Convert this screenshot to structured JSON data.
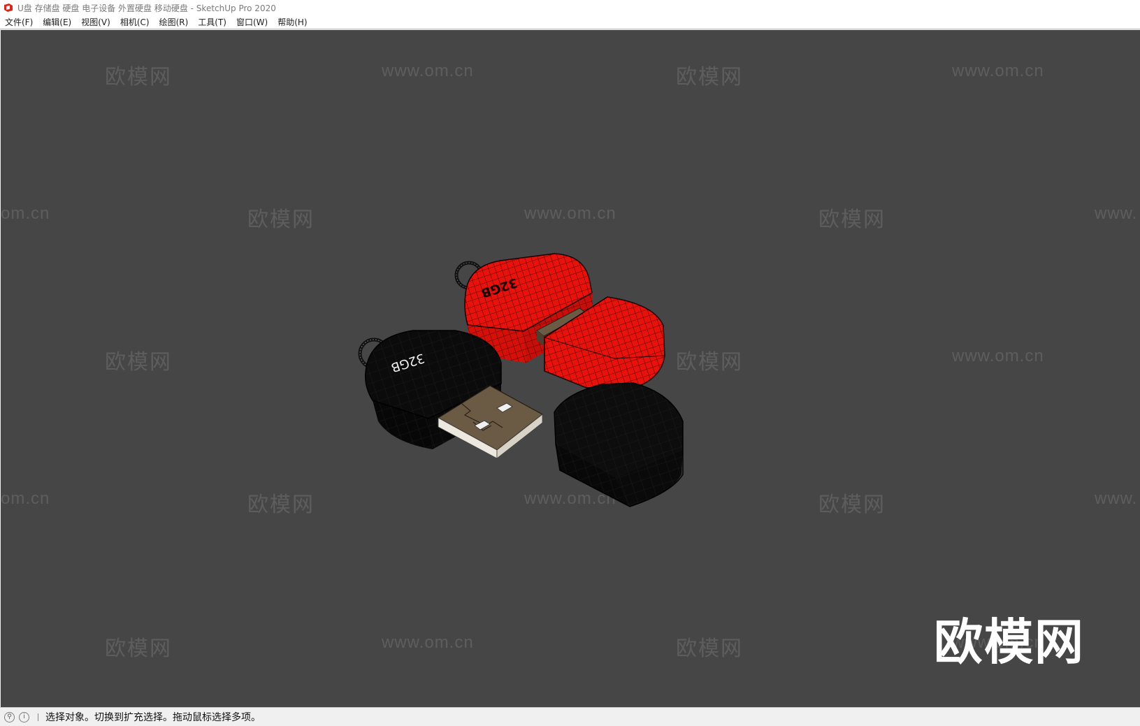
{
  "window": {
    "title": "U盘 存储盘 硬盘 电子设备 外置硬盘 移动硬盘 - SketchUp Pro 2020",
    "app_icon": "sketchup-icon"
  },
  "menu": {
    "items": [
      "文件(F)",
      "编辑(E)",
      "视图(V)",
      "相机(C)",
      "绘图(R)",
      "工具(T)",
      "窗口(W)",
      "帮助(H)"
    ]
  },
  "viewport": {
    "background": "#464646",
    "watermark_cn": "欧模网",
    "watermark_url": "www.om.cn",
    "watermark_url_partial_left": "om.cn",
    "watermark_url_partial_right": "www.",
    "logo_text": "欧模网",
    "model": {
      "drive_label_red": "32GB",
      "drive_label_black": "32GB",
      "colors": {
        "red_body": "#e8120c",
        "black_body": "#0a0a0a",
        "connector": "#6b5a44"
      }
    }
  },
  "statusbar": {
    "icons": [
      "geo-location-icon",
      "info-icon"
    ],
    "text": "选择对象。切换到扩充选择。拖动鼠标选择多项。"
  }
}
